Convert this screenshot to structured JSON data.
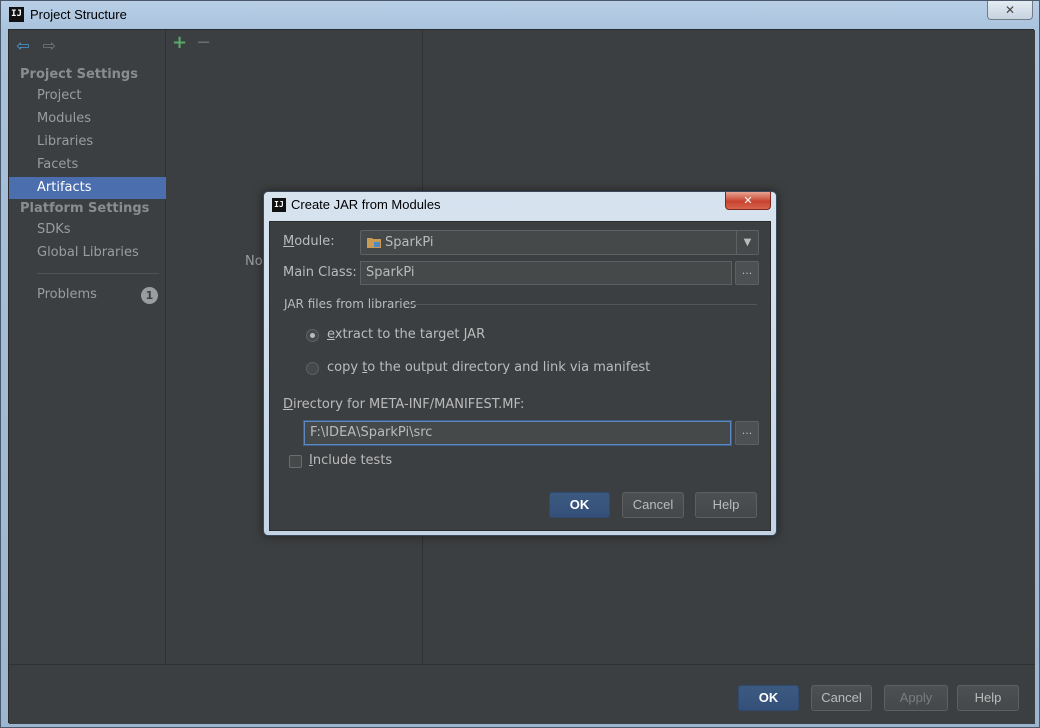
{
  "window": {
    "title": "Project Structure",
    "app_icon_text": "IJ",
    "close_glyph": "✕"
  },
  "sidebar": {
    "nav": {
      "back_icon": "arrow-left-icon",
      "forward_icon": "arrow-right-icon"
    },
    "project_settings_header": "Project Settings",
    "project_items": [
      "Project",
      "Modules",
      "Libraries",
      "Facets",
      "Artifacts"
    ],
    "selected_item": "Artifacts",
    "platform_settings_header": "Platform Settings",
    "platform_items": [
      "SDKs",
      "Global Libraries"
    ],
    "problems_label": "Problems",
    "problems_count": "1"
  },
  "middle": {
    "add_glyph": "+",
    "remove_glyph": "−",
    "empty_text": "No"
  },
  "footer": {
    "ok_label": "OK",
    "cancel_label": "Cancel",
    "apply_label": "Apply",
    "help_label": "Help"
  },
  "dialog": {
    "title": "Create JAR from Modules",
    "icon_text": "IJ",
    "close_glyph": "✕",
    "module_label_u": "M",
    "module_label_rest": "odule:",
    "module_value": "SparkPi",
    "main_class_label": "Main Class:",
    "main_class_value": "SparkPi",
    "dots": "...",
    "group_title": "JAR files from libraries",
    "radio_extract_u": "e",
    "radio_extract_rest": "xtract to the target JAR",
    "radio_copy_pre": "copy ",
    "radio_copy_u": "t",
    "radio_copy_rest": "o the output directory and link via manifest",
    "selected_radio": "extract",
    "manifest_label_u": "D",
    "manifest_label_rest": "irectory for META-INF/MANIFEST.MF:",
    "manifest_value": "F:\\IDEA\\SparkPi\\src",
    "include_tests_u": "I",
    "include_tests_rest": "nclude tests",
    "include_tests_checked": false,
    "ok_label": "OK",
    "cancel_label": "Cancel",
    "help_label": "Help"
  },
  "colors": {
    "accent_selection": "#4b6eaf",
    "add_green": "#59a869",
    "dialog_bg": "#3c3f41",
    "text": "#bbbbbb"
  }
}
